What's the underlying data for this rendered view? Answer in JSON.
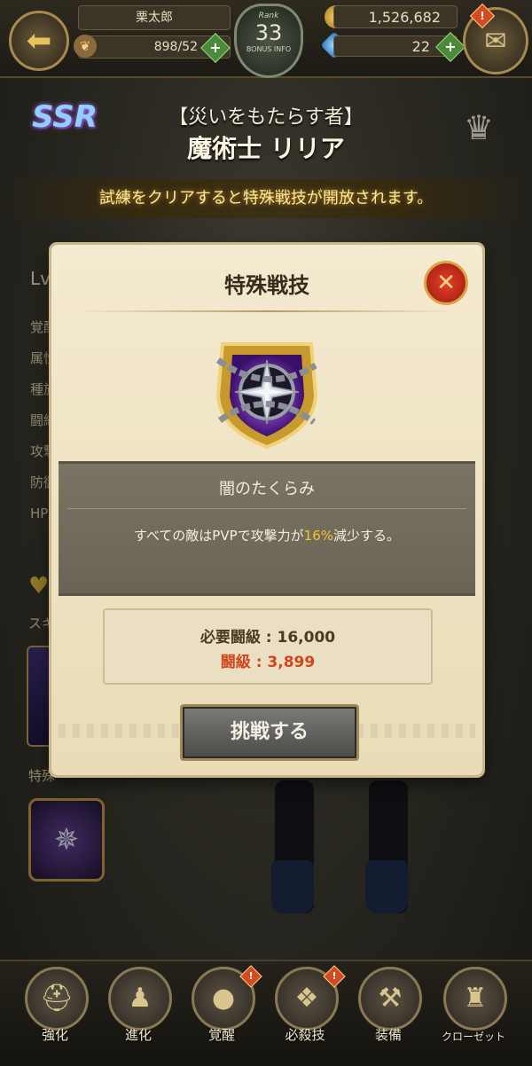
{
  "topbar": {
    "player_name": "栗太郎",
    "stamina": "898/52",
    "rank_label": "Rank",
    "rank_value": "33",
    "rank_sub": "BONUS INFO",
    "gold": "1,526,682",
    "gems": "22"
  },
  "character": {
    "rarity": "SSR",
    "epithet": "【災いをもたらす者】",
    "name": "魔術士 リリア",
    "trial_notice": "試練をクリアすると特殊戦技が開放されます。"
  },
  "background": {
    "level_label": "Lv",
    "stat_labels": [
      "覚醒",
      "属性",
      "種族",
      "闘級",
      "攻撃",
      "防御",
      "HP"
    ],
    "skill_label": "スキ",
    "special_label": "特殊"
  },
  "modal": {
    "title": "特殊戦技",
    "skill_name": "闇のたくらみ",
    "desc_pre": "すべての敵はPVPで攻撃力が",
    "desc_highlight": "16%",
    "desc_post": "減少する。",
    "required_label": "必要闘級 : 16,000",
    "current_label": "闘級 : 3,899",
    "challenge_button": "挑戦する"
  },
  "bottom_nav": [
    {
      "label": "強化",
      "icon": "helmet-icon"
    },
    {
      "label": "進化",
      "icon": "evolve-icon"
    },
    {
      "label": "覚醒",
      "icon": "awaken-orb-icon"
    },
    {
      "label": "必殺技",
      "icon": "special-move-icon"
    },
    {
      "label": "装備",
      "icon": "equipment-icon"
    },
    {
      "label": "クローゼット",
      "icon": "closet-icon"
    }
  ],
  "colors": {
    "accent_gold": "#f5c431",
    "warning_red": "#d2441c",
    "banner_text": "#ffe9a0"
  }
}
